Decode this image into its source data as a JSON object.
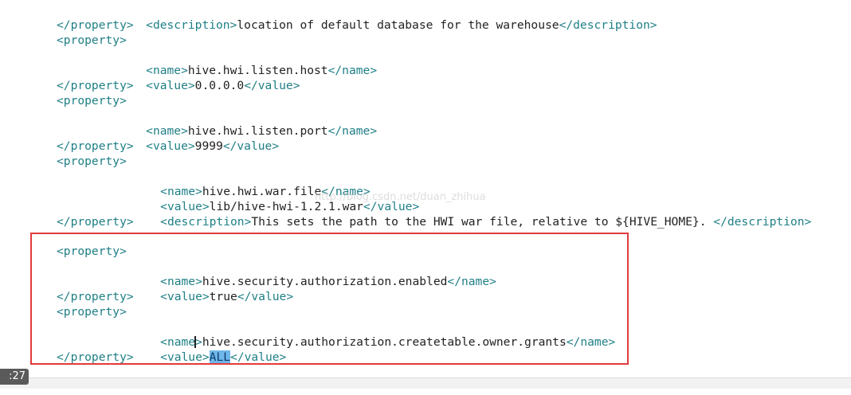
{
  "lines": [
    {
      "open": "<description>",
      "text": "location of default database for the warehouse",
      "close": "</description>"
    },
    {
      "open": "</property>"
    },
    {
      "open": "<property>"
    },
    {
      "open": "<name>",
      "text": "hive.hwi.listen.host",
      "close": "</name>"
    },
    {
      "open": "<value>",
      "text": "0.0.0.0",
      "close": "</value>"
    },
    {
      "open": "</property>"
    },
    {
      "open": "<property>"
    },
    {
      "open": "<name>",
      "text": "hive.hwi.listen.port",
      "close": "</name>"
    },
    {
      "open": "<value>",
      "text": "9999",
      "close": "</value>"
    },
    {
      "open": "</property>"
    },
    {
      "open": "<property>"
    },
    {
      "open": "<name>",
      "text": "hive.hwi.war.file",
      "close": "</name>"
    },
    {
      "open": "<value>",
      "text": "lib/hive-hwi-1.2.1.war",
      "close": "</value>"
    },
    {
      "open": "<description>",
      "text": "This sets the path to the HWI war file, relative to ${HIVE_HOME}. ",
      "close": "</description>"
    },
    {
      "open": "</property>"
    },
    {
      "open": "<property>"
    },
    {
      "open": "<name>",
      "text": "hive.security.authorization.enabled",
      "close": "</name>"
    },
    {
      "open": "<value>",
      "text": "true",
      "close": "</value>"
    },
    {
      "open": "</property>"
    },
    {
      "open": "<property>"
    },
    {
      "open": "<name>",
      "text": "hive.security.authorization.createtable.owner.grants",
      "close": "</name>"
    },
    {
      "open": "<value>",
      "selected": "ALL",
      "close": "</value>"
    },
    {
      "open": "</property>"
    }
  ],
  "watermark": "http://blog.csdn.net/duan_zhihua",
  "video": {
    "time": ":27"
  }
}
